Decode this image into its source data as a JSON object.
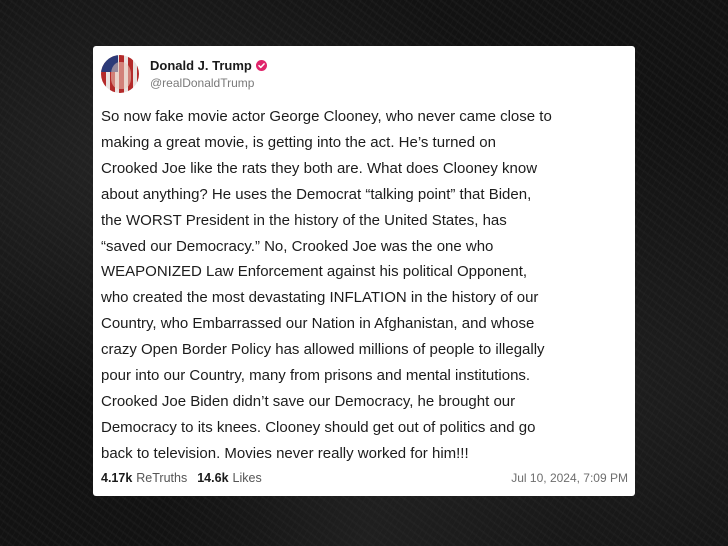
{
  "post": {
    "author": {
      "display_name": "Donald J. Trump",
      "handle": "@realDonaldTrump",
      "verified_color": "#e0246a"
    },
    "lines": [
      "So now fake movie actor George Clooney, who never came close to",
      "making a great movie, is getting into the act. He’s turned on",
      "Crooked Joe like the rats they both are. What does Clooney know",
      "about anything? He uses the Democrat “talking point” that Biden,",
      "the WORST President in the history of the United States, has",
      "“saved our Democracy.” No, Crooked Joe was the one who",
      "WEAPONIZED Law Enforcement against his political Opponent,",
      "who created the most devastating INFLATION in the history of our",
      "Country, who Embarrassed our Nation in Afghanistan, and whose",
      "crazy Open Border Policy has allowed millions of people to illegally",
      "pour into our Country, many from prisons and mental institutions.",
      "Crooked Joe Biden didn’t save our Democracy, he brought our",
      "Democracy to its knees. Clooney should get out of politics and go",
      "back to television. Movies never really worked for him!!!"
    ],
    "stats": {
      "retruths_count": "4.17k",
      "retruths_label": "ReTruths",
      "likes_count": "14.6k",
      "likes_label": "Likes"
    },
    "timestamp": "Jul 10, 2024, 7:09 PM"
  }
}
